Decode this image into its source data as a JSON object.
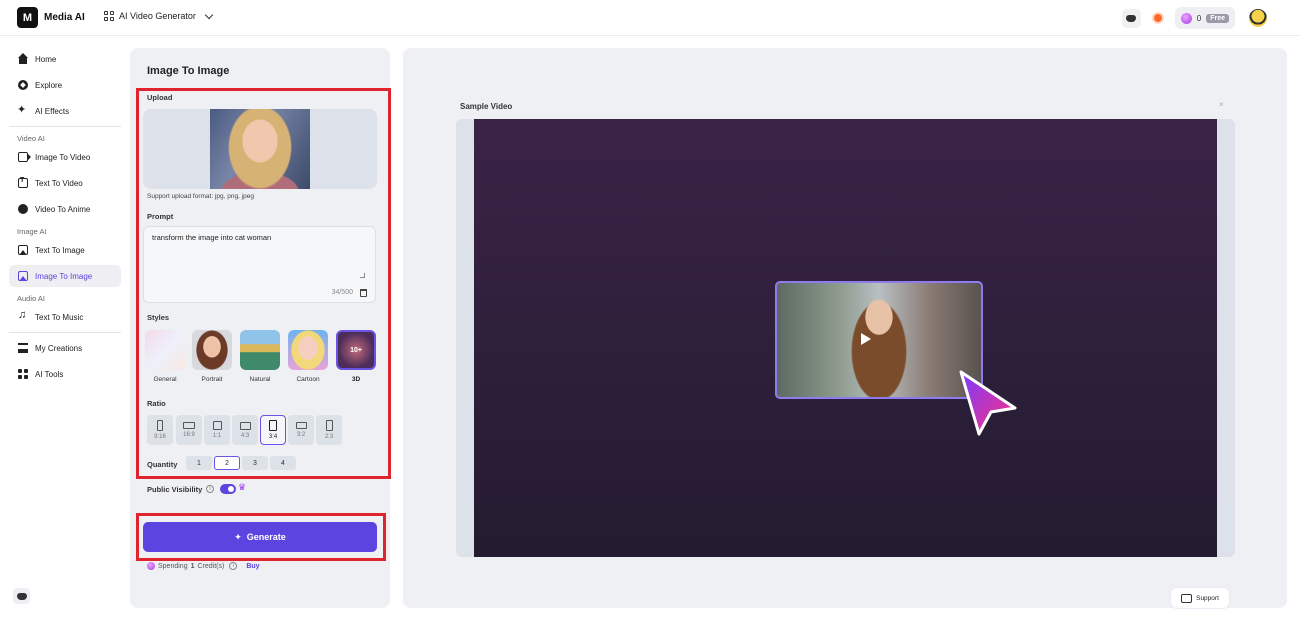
{
  "header": {
    "app_name": "Media AI",
    "tool_switcher": "AI Video Generator",
    "credits": "0",
    "plan": "Free"
  },
  "sidebar": {
    "items": [
      {
        "label": "Home",
        "icon": "home-icon"
      },
      {
        "label": "Explore",
        "icon": "explore-icon"
      },
      {
        "label": "AI Effects",
        "icon": "sparkle-icon"
      }
    ],
    "sections": [
      {
        "title": "Video AI",
        "items": [
          {
            "label": "Image To Video",
            "icon": "video-icon"
          },
          {
            "label": "Text To Video",
            "icon": "text-icon"
          },
          {
            "label": "Video To Anime",
            "icon": "anime-icon"
          }
        ]
      },
      {
        "title": "Image AI",
        "items": [
          {
            "label": "Text To Image",
            "icon": "image-icon"
          },
          {
            "label": "Image To Image",
            "icon": "image-icon",
            "active": true
          }
        ]
      },
      {
        "title": "Audio AI",
        "items": [
          {
            "label": "Text To Music",
            "icon": "music-icon"
          }
        ]
      }
    ],
    "bottom_items": [
      {
        "label": "My Creations",
        "icon": "creations-icon"
      },
      {
        "label": "AI Tools",
        "icon": "apps-icon"
      }
    ]
  },
  "panel": {
    "title": "Image To Image",
    "upload_label": "Upload",
    "upload_hint": "Support upload format: jpg, png, jpeg",
    "prompt_label": "Prompt",
    "prompt_value": "transform the image into cat woman",
    "prompt_counter": "34/500",
    "styles_label": "Styles",
    "styles": [
      {
        "label": "General"
      },
      {
        "label": "Portrait"
      },
      {
        "label": "Natural"
      },
      {
        "label": "Cartoon"
      },
      {
        "label": "3D",
        "badge": "10+",
        "active": true
      }
    ],
    "ratio_label": "Ratio",
    "ratios": [
      "9:16",
      "16:9",
      "1:1",
      "4:3",
      "3:4",
      "3:2",
      "2:3"
    ],
    "ratio_selected": "3:4",
    "quantity_label": "Quantity",
    "quantities": [
      "1",
      "2",
      "3",
      "4"
    ],
    "quantity_selected": "2",
    "visibility_label": "Public Visibility",
    "visibility_on": true,
    "generate_label": "Generate",
    "spending_prefix": "Spending",
    "spending_amount": "1",
    "spending_suffix": "Credit(s)",
    "buy_label": "Buy"
  },
  "preview": {
    "title": "Sample Video",
    "close": "×"
  },
  "support_label": "Support",
  "colors": {
    "accent": "#5b45e0",
    "highlight": "#e0242e"
  }
}
